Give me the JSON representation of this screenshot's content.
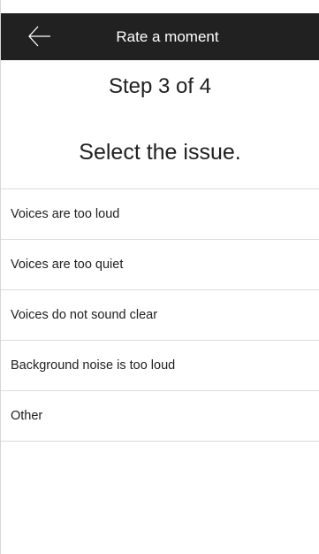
{
  "header": {
    "title": "Rate a moment",
    "back_icon": "arrow-left-icon"
  },
  "step_label": "Step 3 of 4",
  "prompt": "Select the issue.",
  "issues": [
    {
      "label": "Voices are too loud"
    },
    {
      "label": "Voices are too quiet"
    },
    {
      "label": "Voices do not sound clear"
    },
    {
      "label": "Background noise is too loud"
    },
    {
      "label": "Other"
    }
  ],
  "colors": {
    "header_bg": "#212121",
    "header_text": "#ffffff",
    "divider": "#dcdcdc",
    "text": "#212121"
  }
}
